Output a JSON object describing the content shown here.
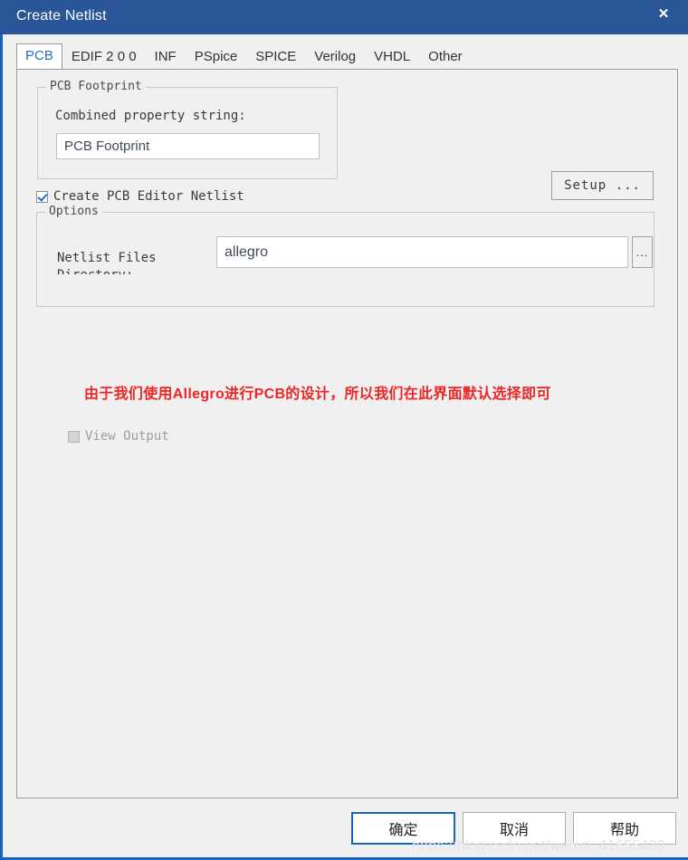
{
  "window": {
    "title": "Create Netlist",
    "close_icon": "close-icon",
    "titlebar_color": "#2a5699",
    "accent_color": "#1565c0"
  },
  "tabs": [
    {
      "label": "PCB",
      "selected": true
    },
    {
      "label": "EDIF 2 0 0",
      "selected": false
    },
    {
      "label": "INF",
      "selected": false
    },
    {
      "label": "PSpice",
      "selected": false
    },
    {
      "label": "SPICE",
      "selected": false
    },
    {
      "label": "Verilog",
      "selected": false
    },
    {
      "label": "VHDL",
      "selected": false
    },
    {
      "label": "Other",
      "selected": false
    }
  ],
  "pcb_tab": {
    "footprint_group": {
      "legend": "PCB Footprint",
      "combined_label": "Combined property string:",
      "combined_value": "PCB Footprint",
      "combined_placeholder": "PCB Footprint"
    },
    "create_netlist_checkbox": {
      "label": "Create PCB Editor Netlist",
      "checked": true
    },
    "setup_button": "Setup ...",
    "options_group": {
      "legend": "Options",
      "netlist_files_label": "Netlist Files Directory:",
      "netlist_files_value": "allegro",
      "netlist_files_placeholder": "allegro",
      "browse_button": "...",
      "view_output_checkbox": {
        "label": "View Output",
        "checked": false,
        "disabled": true
      }
    }
  },
  "annotation": {
    "text": "由于我们使用Allegro进行PCB的设计，所以我们在此界面默认选择即可",
    "color": "#ef2424"
  },
  "buttons": {
    "ok": "确定",
    "cancel": "取消",
    "help": "帮助"
  },
  "watermark": "https://blog.csdn.net/weixin_41655430"
}
